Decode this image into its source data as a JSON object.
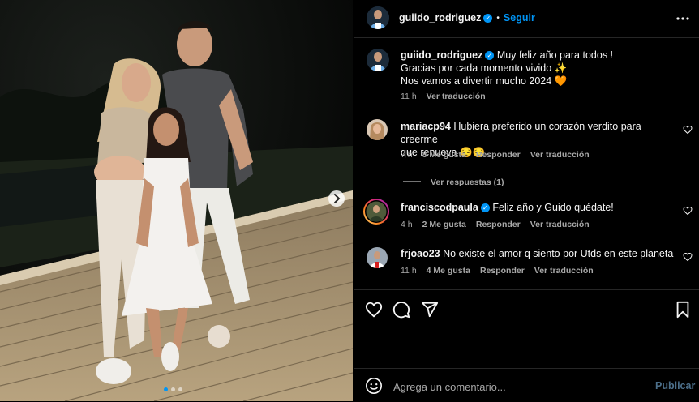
{
  "post": {
    "username": "guiido_rodriguez",
    "follow_label": "Seguir",
    "more_icon": "more-horizontal-icon",
    "caption_lines": [
      "Muy feliz año para todos !",
      "Gracias por cada momento vivido ✨",
      "Nos vamos a divertir mucho 2024 🧡"
    ],
    "time": "11 h",
    "translate": "Ver traducción",
    "carousel_dots": 3,
    "carousel_active": 0
  },
  "comments": [
    {
      "username": "mariacp94",
      "verified": false,
      "text_line1": "Hubiera preferido un corazón verdito para creerme",
      "text_line2": "que renueva 😔😔",
      "time": "7 h",
      "likes": "8 Me gusta",
      "reply": "Responder",
      "translate": "Ver traducción",
      "view_replies": "Ver respuestas (1)"
    },
    {
      "username": "franciscodpaula",
      "verified": true,
      "text_line1": "Feliz año y Guido quédate!",
      "time": "4 h",
      "likes": "2 Me gusta",
      "reply": "Responder",
      "translate": "Ver traducción"
    },
    {
      "username": "frjoao23",
      "verified": false,
      "text_line1": "No existe el amor q siento por Utds en este planeta",
      "time": "11 h",
      "likes": "4 Me gusta",
      "reply": "Responder",
      "translate": "Ver traducción"
    }
  ],
  "actions": {
    "like_icon": "heart-icon",
    "comment_icon": "comment-icon",
    "share_icon": "send-icon",
    "save_icon": "bookmark-icon"
  },
  "composer": {
    "emoji_icon": "emoji-icon",
    "placeholder": "Agrega un comentario...",
    "publish_label": "Publicar"
  },
  "colors": {
    "accent": "#0095f6",
    "background": "#000000",
    "muted": "#a8a8a8",
    "divider": "#262626"
  }
}
